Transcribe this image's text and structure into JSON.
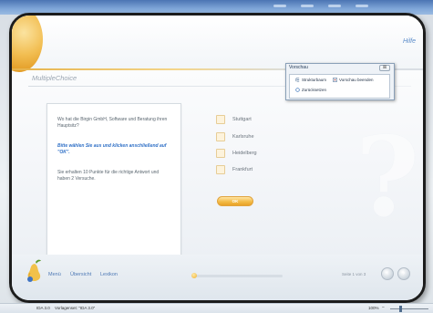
{
  "header": {
    "help_label": "Hilfe",
    "section_title": "MultipleChoice"
  },
  "question": {
    "text": "Wo hat die Birgin GmbH, Software und Beratung ihren Hauptsitz?",
    "instruction": "Bitte wählen Sie aus und klicken anschließend auf \"OK\".",
    "info": "Sie erhalten 10 Punkte für die richtige Antwort und haben 2 Versuche."
  },
  "answers": [
    {
      "label": "Stuttgart",
      "checked": false
    },
    {
      "label": "Karlsruhe",
      "checked": false
    },
    {
      "label": "Heidelberg",
      "checked": false
    },
    {
      "label": "Frankfurt",
      "checked": false
    }
  ],
  "ok_label": "OK",
  "preview_dialog": {
    "title": "Vorschau",
    "close_label": "⊠",
    "structure_tree_label": "Strukturbaum",
    "end_preview_label": "Vorschau beenden",
    "reset_label": "Zurücksetzen"
  },
  "footer": {
    "menu_label": "Menü",
    "overview_label": "Übersicht",
    "lexicon_label": "Lexikon",
    "page_info": "Seite 1 von 3",
    "progress": 0.0
  },
  "statusbar": {
    "version": "IDA 3.0",
    "template": "Vorlagenset: \"IDA 3.0\"",
    "zoom": "100%"
  },
  "colors": {
    "accent_orange": "#f3bb47",
    "link_blue": "#4d79b5",
    "instruction_blue": "#2e6fc6"
  }
}
